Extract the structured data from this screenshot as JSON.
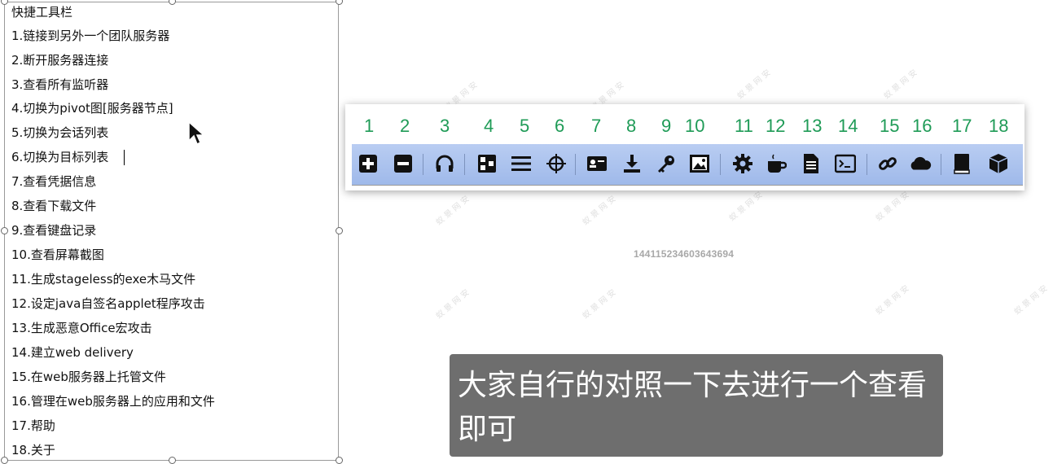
{
  "textbox": {
    "lines": [
      "快捷工具栏",
      "1.链接到另外一个团队服务器",
      "2.断开服务器连接",
      "3.查看所有监听器",
      "4.切换为pivot图[服务器节点]",
      "5.切换为会话列表",
      "6.切换为目标列表",
      "7.查看凭据信息",
      "8.查看下载文件",
      "9.查看键盘记录",
      "10.查看屏幕截图",
      "11.生成stageless的exe木马文件",
      "12.设定java自签名applet程序攻击",
      "13.生成恶意Office宏攻击",
      "14.建立web delivery",
      "15.在web服务器上托管文件",
      "16.管理在web服务器上的应用和文件",
      "17.帮助",
      "18.关于"
    ]
  },
  "toolbar": {
    "numbers": [
      "1",
      "2",
      "3",
      "4",
      "5",
      "6",
      "7",
      "8",
      "9",
      "10",
      "11",
      "12",
      "13",
      "14",
      "15",
      "16",
      "17",
      "18"
    ],
    "icons": [
      "plus-square-icon",
      "minus-square-icon",
      "headphones-icon",
      "pivot-graph-icon",
      "list-icon",
      "crosshair-icon",
      "credentials-card-icon",
      "download-icon",
      "key-icon",
      "screenshot-image-icon",
      "gear-icon",
      "coffee-cup-icon",
      "document-icon",
      "terminal-icon",
      "link-icon",
      "cloud-icon",
      "book-icon",
      "cube-icon"
    ],
    "number_color": "#1f9b57",
    "strip_color": "#a9c1ee"
  },
  "id_text": "144115234603643694",
  "subtitle": "大家自行的对照一下去进行一个查看即可"
}
